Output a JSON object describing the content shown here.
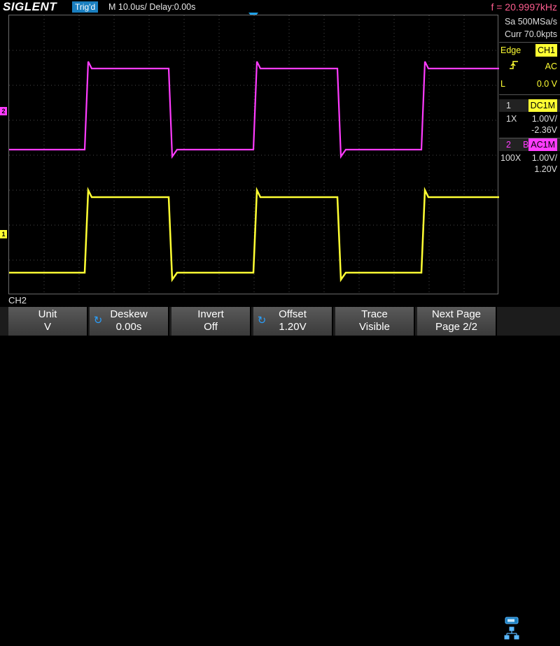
{
  "header": {
    "logo": "SIGLENT",
    "trigger_status": "Trig'd",
    "timebase": "M 10.0us/  Delay:0.00s",
    "frequency": "f = 20.9997kHz"
  },
  "acquisition": {
    "sample_rate": "Sa 500MSa/s",
    "memory": "Curr 70.0kpts"
  },
  "trigger": {
    "type": "Edge",
    "source": "CH1",
    "coupling": "AC",
    "level_label": "L",
    "level": "0.0 V"
  },
  "channels": [
    {
      "number": "1",
      "coupling": "DC1M",
      "probe": "1X",
      "scale": "1.00V/",
      "offset": "-2.36V",
      "color": "#ffff33"
    },
    {
      "number": "2",
      "bw": "B",
      "coupling": "AC1M",
      "probe": "100X",
      "scale": "1.00V/",
      "offset": "1.20V",
      "color": "#ff3cff"
    }
  ],
  "markers": {
    "ch1": "1",
    "ch2": "2"
  },
  "menu": {
    "title": "CH2",
    "items": [
      {
        "label": "Unit",
        "value": "V"
      },
      {
        "label": "Deskew",
        "value": "0.00s"
      },
      {
        "label": "Invert",
        "value": "Off"
      },
      {
        "label": "Offset",
        "value": "1.20V"
      },
      {
        "label": "Trace",
        "value": "Visible"
      },
      {
        "label": "Next Page",
        "value": "Page 2/2"
      }
    ]
  },
  "icons": {
    "knob": "rotary-knob-icon",
    "network": "network-icon",
    "usb": "usb-icon"
  }
}
